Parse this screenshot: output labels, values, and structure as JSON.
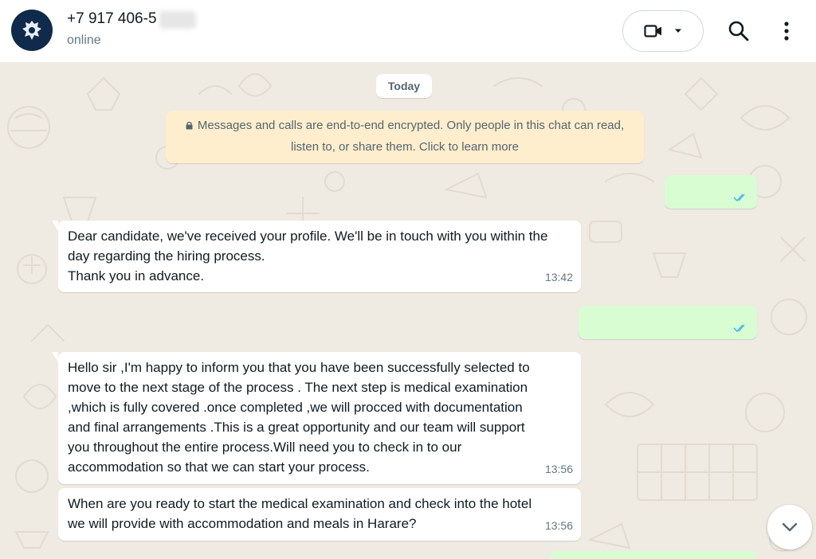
{
  "header": {
    "contact_name": "+7 917 406-5",
    "status": "online",
    "avatar_icon": "emblem-avatar",
    "video_icon": "video-camera-icon",
    "search_icon": "search-icon",
    "menu_icon": "kebab-menu-icon"
  },
  "chat": {
    "date_label": "Today",
    "encryption_line1": "Messages and calls are end-to-end encrypted. Only people in this chat can read,",
    "encryption_line2": "listen to, or share them. Click to learn more",
    "messages": [
      {
        "text": "Dear candidate, we've received your profile. We'll be in touch with you within the\nday regarding the hiring process.\nThank you in advance.",
        "time": "13:42"
      },
      {
        "text": "Hello sir ,I'm happy to inform you that you have been successfully selected to\nmove to the next stage of the process . The next step is medical examination\n,which is fully covered .once completed ,we will procced with documentation\nand final arrangements .This is a great opportunity and our team will support\nyou throughout the entire process.Will need you to check in to our\naccommodation so that we can start your process.",
        "time": "13:56"
      },
      {
        "text": "When are you ready to start the medical examination and check into the hotel\nwe will provide with accommodation and meals in Harare?",
        "time": "13:56"
      }
    ]
  },
  "colors": {
    "incoming_bubble": "#ffffff",
    "outgoing_bubble": "#d9fdd3",
    "chat_background": "#efeae2",
    "encryption_note": "#ffeecd",
    "read_ticks": "#53bdeb"
  }
}
